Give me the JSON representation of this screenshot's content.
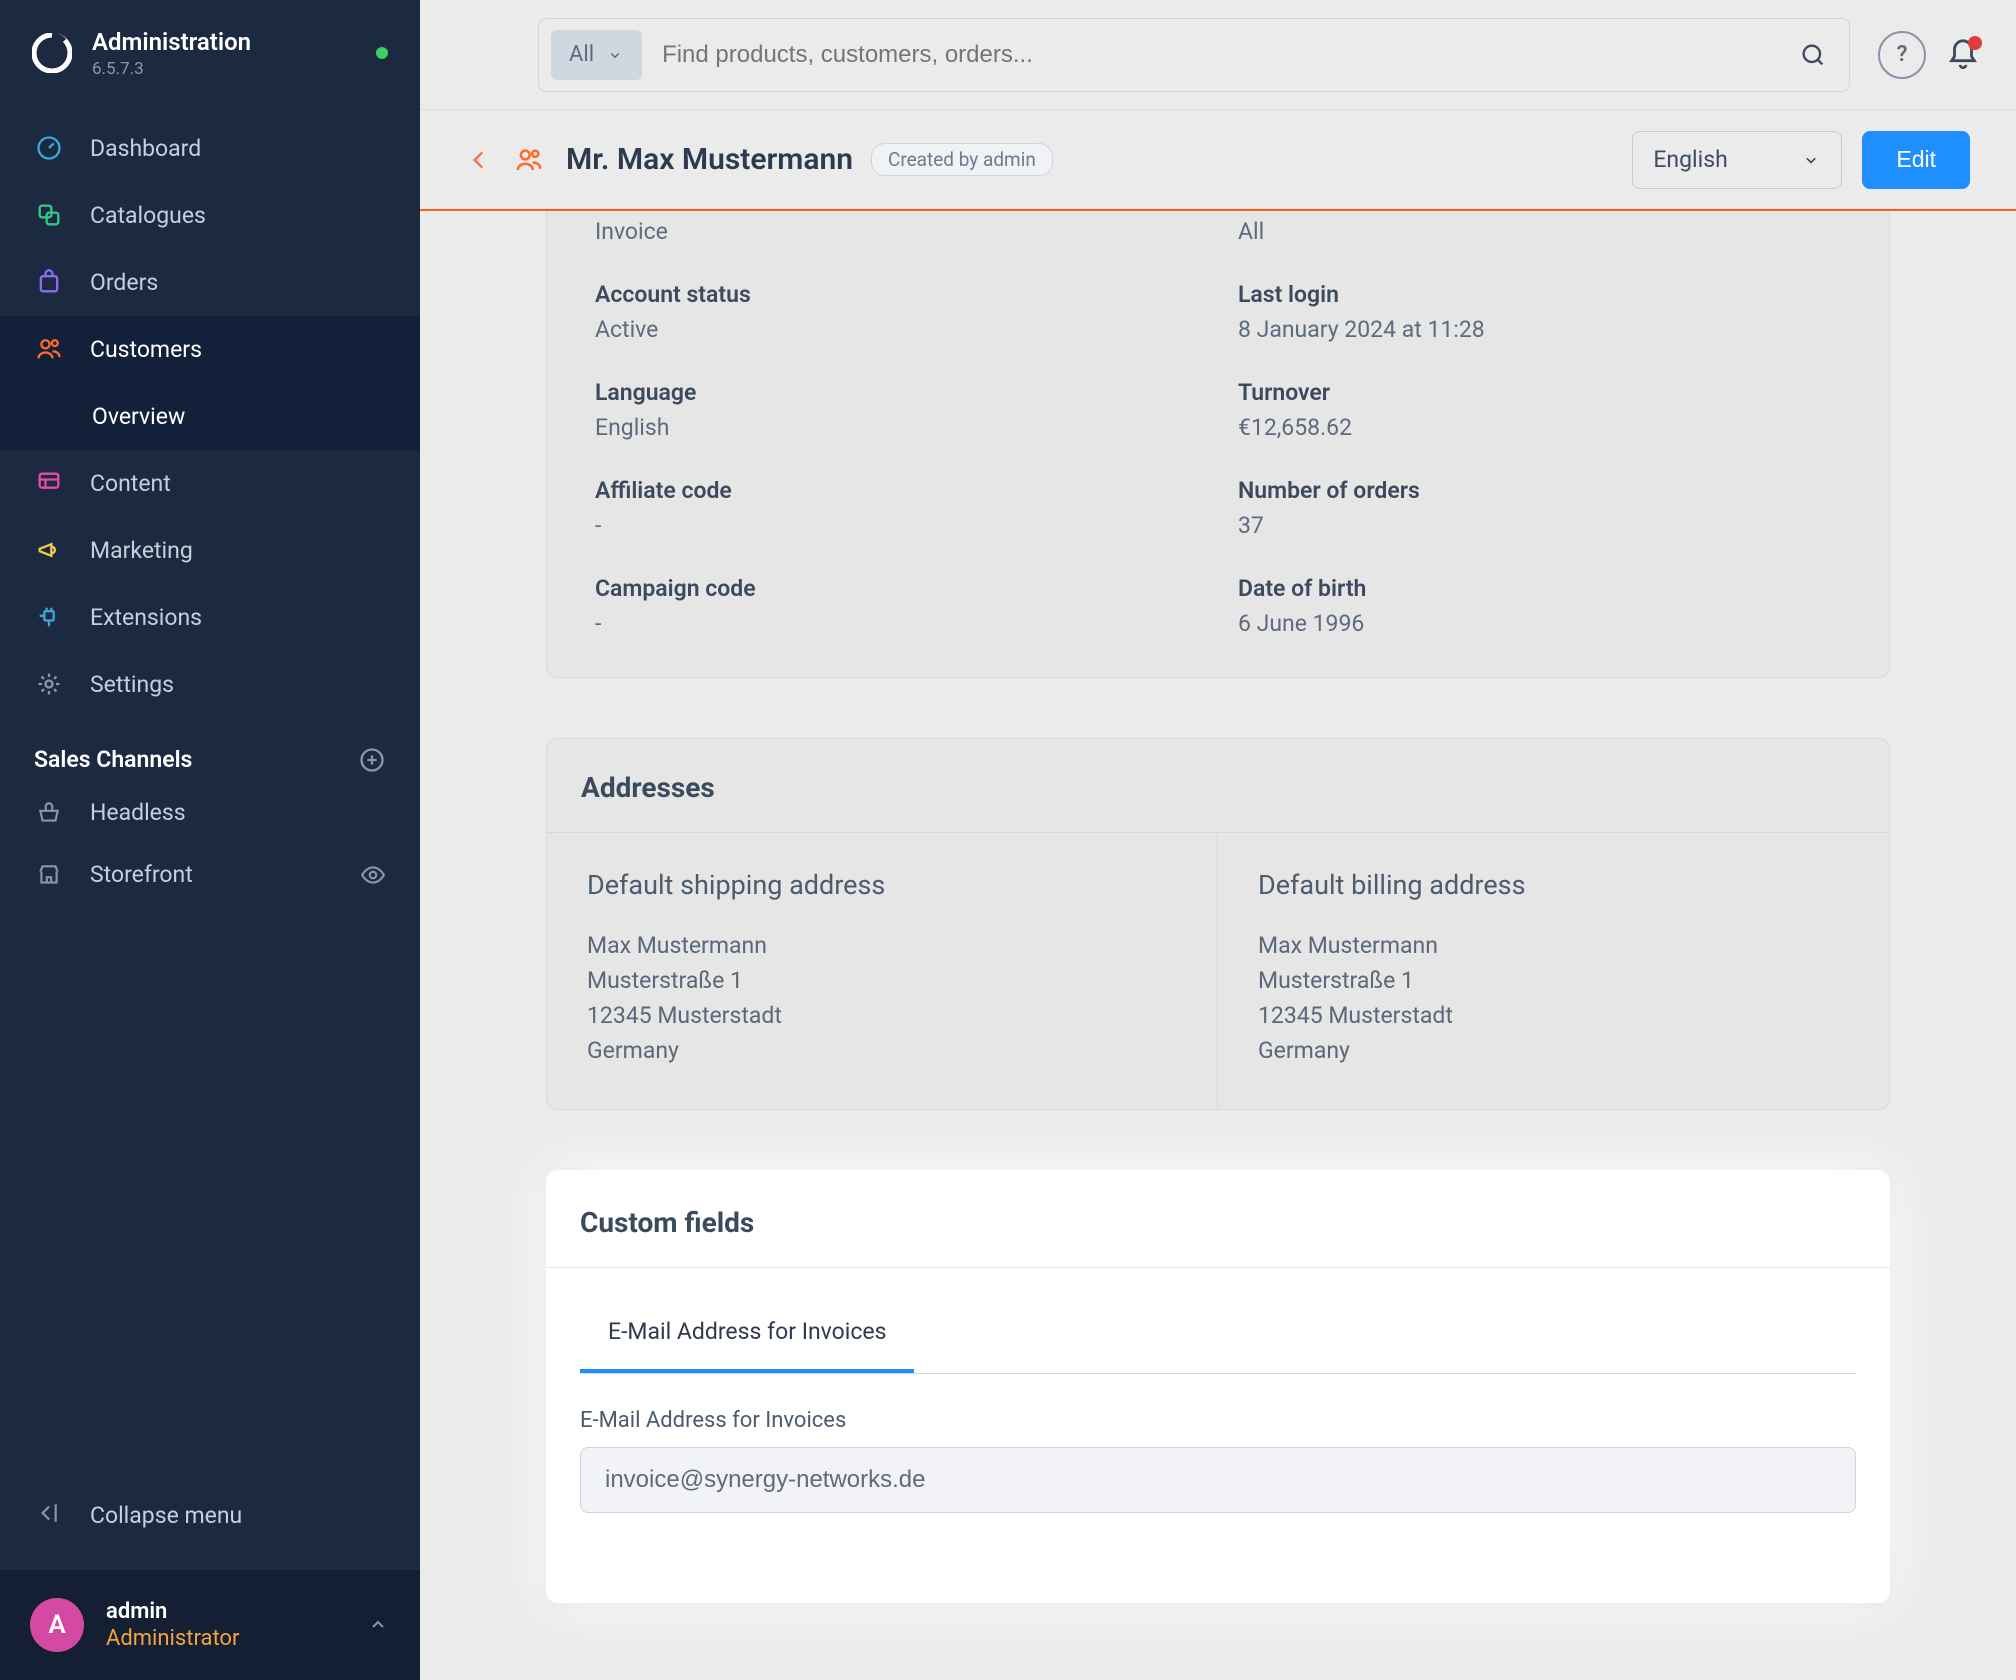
{
  "sidebar": {
    "title": "Administration",
    "version": "6.5.7.3",
    "items": [
      {
        "label": "Dashboard",
        "icon": "dashboard"
      },
      {
        "label": "Catalogues",
        "icon": "catalogues"
      },
      {
        "label": "Orders",
        "icon": "orders"
      },
      {
        "label": "Customers",
        "icon": "customers",
        "active": true,
        "sub": "Overview"
      },
      {
        "label": "Content",
        "icon": "content"
      },
      {
        "label": "Marketing",
        "icon": "marketing"
      },
      {
        "label": "Extensions",
        "icon": "extensions"
      },
      {
        "label": "Settings",
        "icon": "settings"
      }
    ],
    "sales_channels_label": "Sales Channels",
    "channels": [
      {
        "label": "Headless",
        "icon": "basket"
      },
      {
        "label": "Storefront",
        "icon": "store",
        "eye": true
      }
    ],
    "collapse_label": "Collapse menu",
    "user": {
      "initial": "A",
      "name": "admin",
      "role": "Administrator"
    }
  },
  "topbar": {
    "filter_chip": "All",
    "search_placeholder": "Find products, customers, orders..."
  },
  "page_header": {
    "title": "Mr. Max Mustermann",
    "badge": "Created by admin",
    "language": "English",
    "edit_label": "Edit"
  },
  "info": {
    "rows": [
      {
        "l1": "Invoice",
        "r1": "All",
        "hideLabels": true
      },
      {
        "llabel": "Account status",
        "lval": "Active",
        "rlabel": "Last login",
        "rval": "8 January 2024 at 11:28"
      },
      {
        "llabel": "Language",
        "lval": "English",
        "rlabel": "Turnover",
        "rval": "€12,658.62"
      },
      {
        "llabel": "Affiliate code",
        "lval": "-",
        "rlabel": "Number of orders",
        "rval": "37"
      },
      {
        "llabel": "Campaign code",
        "lval": "-",
        "rlabel": "Date of birth",
        "rval": "6 June 1996"
      }
    ]
  },
  "addresses": {
    "heading": "Addresses",
    "shipping": {
      "title": "Default shipping address",
      "name": "Max Mustermann",
      "street": "Musterstraße 1",
      "city": "12345 Musterstadt",
      "country": "Germany"
    },
    "billing": {
      "title": "Default billing address",
      "name": "Max Mustermann",
      "street": "Musterstraße 1",
      "city": "12345 Musterstadt",
      "country": "Germany"
    }
  },
  "custom_fields": {
    "heading": "Custom fields",
    "tab": "E-Mail Address for Invoices",
    "field_label": "E-Mail Address for Invoices",
    "field_value": "invoice@synergy-networks.de"
  }
}
